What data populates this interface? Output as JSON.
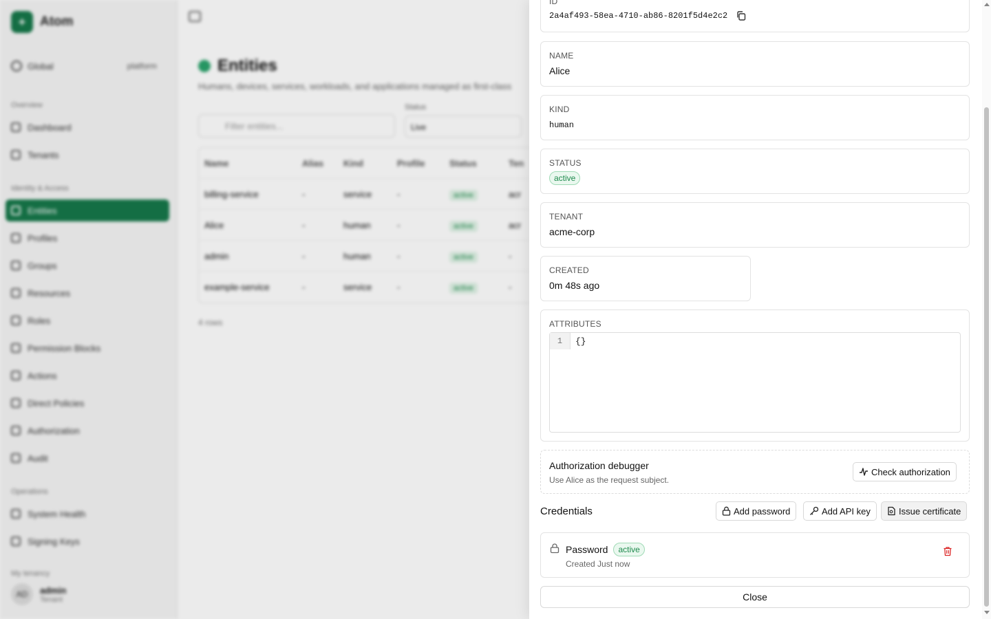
{
  "app": {
    "brand": "Atom",
    "scope_label": "Global",
    "scope_tenant": "platform",
    "sections": {
      "overview": "Overview",
      "identity": "Identity & Access",
      "operations": "Operations",
      "my_tenant": "My tenancy"
    },
    "nav": {
      "dashboard": "Dashboard",
      "tenants": "Tenants",
      "entities": "Entities",
      "profiles": "Profiles",
      "groups": "Groups",
      "resources": "Resources",
      "roles": "Roles",
      "permission_blocks": "Permission Blocks",
      "actions": "Actions",
      "direct_policies": "Direct Policies",
      "authorization": "Authorization",
      "audit": "Audit",
      "system_health": "System Health",
      "signing_keys": "Signing Keys"
    },
    "user": {
      "initials": "AD",
      "name": "admin",
      "role": "Tenant"
    }
  },
  "page": {
    "title": "Entities",
    "subtitle": "Humans, devices, services, workloads, and applications managed as first-class",
    "filter_placeholder": "Filter entities...",
    "status_label": "Status",
    "status_value": "Live",
    "columns": [
      "Name",
      "Alias",
      "Kind",
      "Profile",
      "Status",
      "Ten"
    ],
    "rows": [
      {
        "name": "billing-service",
        "alias": "-",
        "kind": "service",
        "profile": "-",
        "status": "active",
        "tenant": "acr"
      },
      {
        "name": "Alice",
        "alias": "-",
        "kind": "human",
        "profile": "-",
        "status": "active",
        "tenant": "acr"
      },
      {
        "name": "admin",
        "alias": "-",
        "kind": "human",
        "profile": "-",
        "status": "active",
        "tenant": "-"
      },
      {
        "name": "example-service",
        "alias": "-",
        "kind": "service",
        "profile": "-",
        "status": "active",
        "tenant": "-"
      }
    ],
    "count": "4 rows"
  },
  "drawer": {
    "id_label": "ID",
    "id_value": "2a4af493-58ea-4710-ab86-8201f5d4e2c2",
    "name_label": "Name",
    "name_value": "Alice",
    "kind_label": "Kind",
    "kind_value": "human",
    "status_label": "Status",
    "status_value": "active",
    "tenant_label": "Tenant",
    "tenant_value": "acme-corp",
    "created_label": "Created",
    "created_value": "0m 48s ago",
    "attributes_label": "Attributes",
    "attributes_line_no": "1",
    "attributes_code": "{}",
    "debugger_title": "Authorization debugger",
    "debugger_sub": "Use Alice as the request subject.",
    "check_auth_label": "Check authorization",
    "credentials_title": "Credentials",
    "add_password_label": "Add password",
    "add_api_key_label": "Add API key",
    "issue_cert_label": "Issue certificate",
    "credential": {
      "name": "Password",
      "status": "active",
      "created": "Created Just now"
    },
    "close_label": "Close"
  },
  "colors": {
    "accent": "#16784a",
    "success": "#1f8a4d",
    "danger": "#dc2626"
  },
  "icons": [
    "copy-icon",
    "activity-icon",
    "lock-icon",
    "key-icon",
    "certificate-icon",
    "trash-icon"
  ]
}
